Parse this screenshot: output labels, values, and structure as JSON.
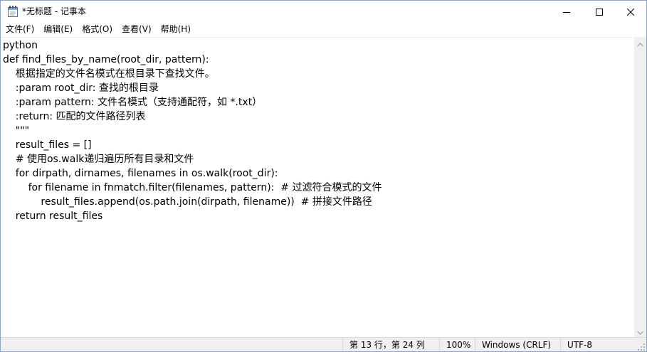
{
  "window": {
    "title": "*无标题 - 记事本",
    "app_icon": "notepad-icon",
    "controls": {
      "minimize_icon": "minimize-icon",
      "maximize_icon": "maximize-icon",
      "close_icon": "close-icon"
    }
  },
  "menubar": {
    "items": [
      {
        "label": "文件(F)"
      },
      {
        "label": "编辑(E)"
      },
      {
        "label": "格式(O)"
      },
      {
        "label": "查看(V)"
      },
      {
        "label": "帮助(H)"
      }
    ]
  },
  "editor": {
    "lines": [
      "python",
      "def find_files_by_name(root_dir, pattern):",
      "    根据指定的文件名模式在根目录下查找文件。",
      "    :param root_dir: 查找的根目录",
      "    :param pattern: 文件名模式（支持通配符，如 *.txt）",
      "    :return: 匹配的文件路径列表",
      "    \"\"\"",
      "    result_files = []",
      "    # 使用os.walk递归遍历所有目录和文件",
      "    for dirpath, dirnames, filenames in os.walk(root_dir):",
      "        for filename in fnmatch.filter(filenames, pattern):  # 过滤符合模式的文件",
      "            result_files.append(os.path.join(dirpath, filename))  # 拼接文件路径",
      "    return result_files"
    ]
  },
  "statusbar": {
    "position": "第 13 行，第 24 列",
    "zoom": "100%",
    "line_ending": "Windows (CRLF)",
    "encoding": "UTF-8"
  },
  "colors": {
    "background": "#ffffff",
    "statusbar": "#f0f0f0",
    "border": "#8fa5c0"
  }
}
